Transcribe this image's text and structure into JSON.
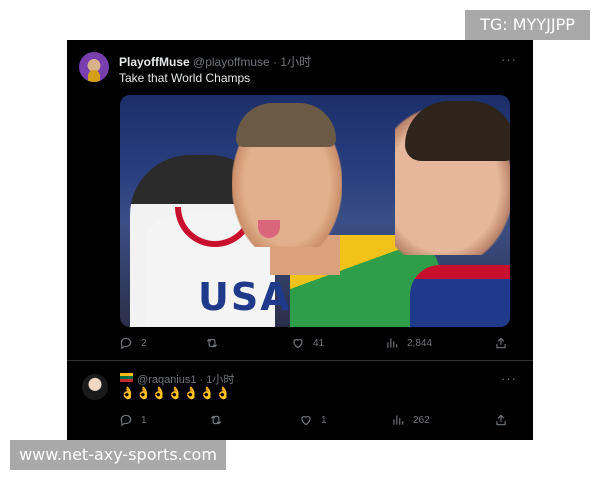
{
  "watermarks": {
    "top_right": "TG: MYYJJPP",
    "bottom_left": "www.net-axy-sports.com"
  },
  "tweet": {
    "display_name": "PlayoffMuse",
    "handle": "@playoffmuse",
    "separator": "·",
    "time": "1小时",
    "text": "Take that World Champs",
    "more": "···",
    "media_jersey_text": "USA",
    "actions": {
      "replies": "2",
      "retweets": "",
      "likes": "41",
      "views": "2,844"
    }
  },
  "reply": {
    "handle": "@raqanius1",
    "separator": "·",
    "time": "1小时",
    "text": "👌👌👌👌👌👌👌",
    "more": "···",
    "flag": "lithuania-flag-icon",
    "actions": {
      "replies": "1",
      "retweets": "",
      "likes": "1",
      "views": "262"
    }
  },
  "colors": {
    "background": "#000000",
    "primary_text": "#e7e9ea",
    "secondary_text": "#71767b",
    "divider": "#2f3336",
    "watermark": "#a9a9a9"
  }
}
